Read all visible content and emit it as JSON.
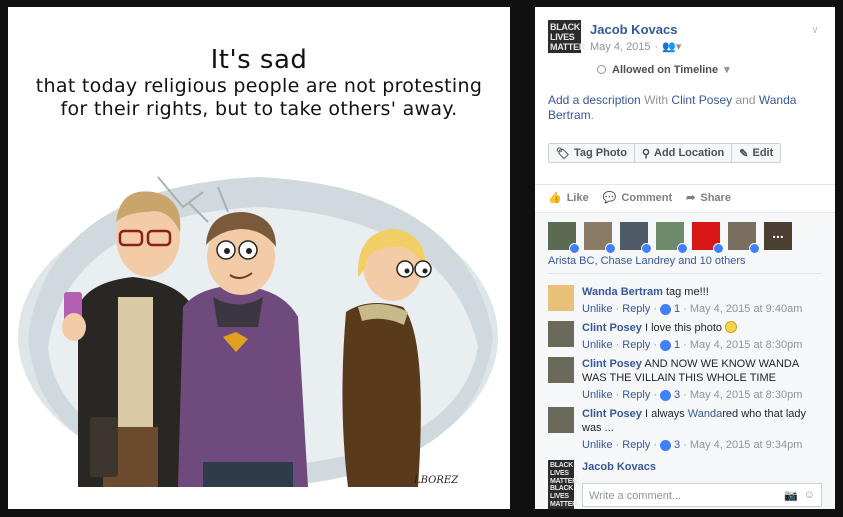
{
  "photo": {
    "title": "It's sad",
    "line1": "that today religious people are not protesting",
    "line2": "for their rights, but to take others' away.",
    "signature": "LBOREZ"
  },
  "post": {
    "avatar_text": [
      "BLACK",
      "LIVES",
      "MATTER"
    ],
    "author": "Jacob Kovacs",
    "date": "May 4, 2015",
    "audience_icon": "friends-icon",
    "timeline_label": "Allowed on Timeline",
    "description": {
      "add": "Add a description",
      "with": "With",
      "person1": "Clint Posey",
      "and": "and",
      "person2": "Wanda Bertram",
      "end": "."
    },
    "buttons": [
      "Tag Photo",
      "Add Location",
      "Edit"
    ]
  },
  "ufi": {
    "like": "Like",
    "comment": "Comment",
    "share": "Share"
  },
  "likers_more": "...",
  "liked_by": "Arista BC, Chase Landrey and 10 others",
  "comments": [
    {
      "name": "Wanda Bertram",
      "text": "tag me!!!",
      "unlike": "Unlike",
      "reply": "Reply",
      "likes": "1",
      "time": "May 4, 2015 at 9:40am"
    },
    {
      "name": "Clint Posey",
      "text": "I love this photo",
      "unlike": "Unlike",
      "reply": "Reply",
      "likes": "1",
      "time": "May 4, 2015 at 8:30pm"
    },
    {
      "name": "Clint Posey",
      "text": "AND NOW WE KNOW WANDA WAS THE VILLAIN THIS WHOLE TIME",
      "unlike": "Unlike",
      "reply": "Reply",
      "likes": "3",
      "time": "May 4, 2015 at 8:30pm"
    },
    {
      "name": "Clint Posey",
      "text_pre": "I always",
      "text_hl": "Wanda",
      "text_post": "red who that lady was ...",
      "unlike": "Unlike",
      "reply": "Reply",
      "likes": "3",
      "time": "May 4, 2015 at 9:34pm"
    }
  ],
  "reply_author": "Jacob Kovacs",
  "write_placeholder": "Write a comment...",
  "colors": {
    "link": "#365899",
    "muted": "#90949c",
    "like_blue": "#4080ff"
  }
}
